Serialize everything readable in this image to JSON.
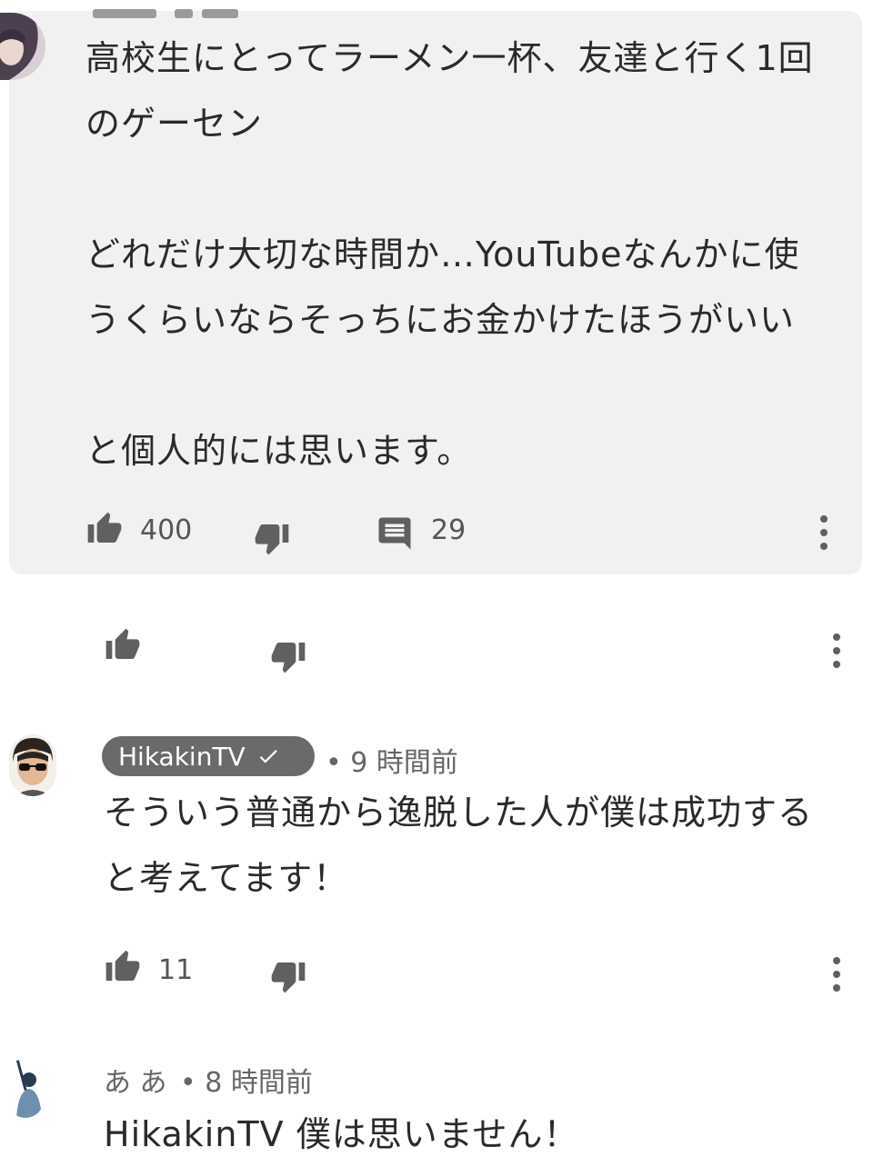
{
  "comments": [
    {
      "text": "高校生にとってラーメン一杯、友達と行く1回\nのゲーセン\n\nどれだけ大切な時間か…YouTubeなんかに使\nうくらいならそっちにお金かけたほうがいい\n\nと個人的には思います。",
      "likes": "400",
      "replies": "29"
    },
    {
      "author": "HikakinTV",
      "time": "• 9 時間前",
      "text": "そういう普通から逸脱した人が僕は成功する\nと考えてます！",
      "likes": "11"
    },
    {
      "author": "あ あ",
      "time": "• 8 時間前",
      "text": "HikakinTV 僕は思いません！"
    }
  ],
  "colors": {
    "card_background": "#f1f1f1",
    "icon": "#606060",
    "badge": "#6a6a6a"
  },
  "icons": [
    "thumb-up-icon",
    "thumb-down-icon",
    "comment-icon",
    "more-vert-icon",
    "verified-check-icon"
  ]
}
